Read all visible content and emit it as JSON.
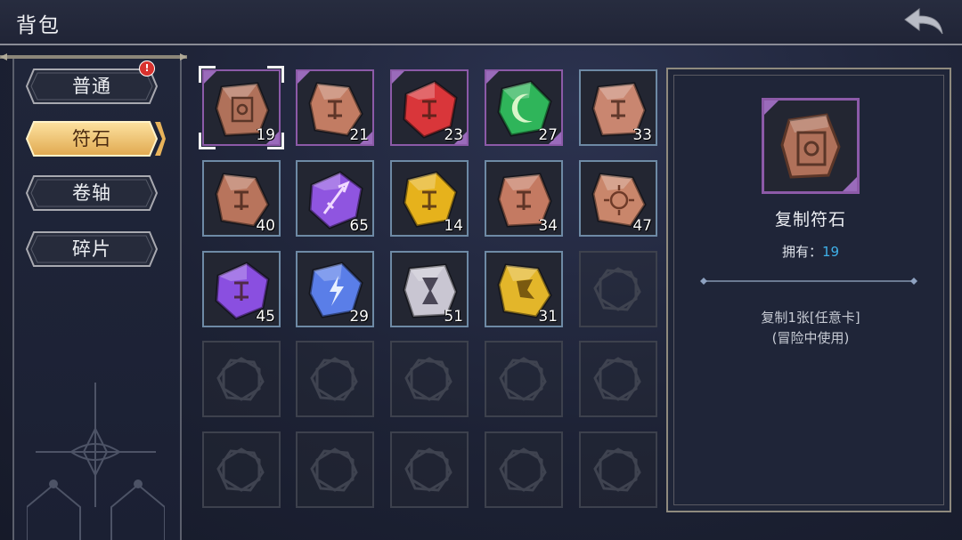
{
  "header": {
    "title": "背包"
  },
  "tabs": [
    {
      "label": "普通",
      "badge": "!"
    },
    {
      "label": "符石"
    },
    {
      "label": "卷轴"
    },
    {
      "label": "碎片"
    }
  ],
  "active_tab": "符石",
  "items": [
    {
      "count": "19",
      "color": "#b0715a",
      "rarity": "purple",
      "icon": "copy-rune"
    },
    {
      "count": "21",
      "color": "#c27c63",
      "rarity": "purple",
      "icon": "rune"
    },
    {
      "count": "23",
      "color": "#d9363a",
      "rarity": "purple",
      "icon": "rune"
    },
    {
      "count": "27",
      "color": "#2fb55a",
      "rarity": "purple",
      "icon": "moon-rune"
    },
    {
      "count": "33",
      "color": "#c98670",
      "rarity": "blue",
      "icon": "rune"
    },
    {
      "count": "40",
      "color": "#b8745c",
      "rarity": "blue",
      "icon": "rune"
    },
    {
      "count": "65",
      "color": "#8f55e0",
      "rarity": "blue",
      "icon": "sword-rune"
    },
    {
      "count": "14",
      "color": "#e6b21c",
      "rarity": "blue",
      "icon": "rune"
    },
    {
      "count": "34",
      "color": "#c47a62",
      "rarity": "blue",
      "icon": "rune"
    },
    {
      "count": "47",
      "color": "#c9866b",
      "rarity": "blue",
      "icon": "sun-rune"
    },
    {
      "count": "45",
      "color": "#8a4fe0",
      "rarity": "blue",
      "icon": "rune"
    },
    {
      "count": "29",
      "color": "#5a7ee8",
      "rarity": "blue",
      "icon": "lightning-rune"
    },
    {
      "count": "51",
      "color": "#c9c6d2",
      "rarity": "blue",
      "icon": "hourglass-rune"
    },
    {
      "count": "31",
      "color": "#e3b62a",
      "rarity": "blue",
      "icon": "star-rune"
    }
  ],
  "detail": {
    "name": "复制符石",
    "owned_label": "拥有：",
    "owned_value": "19",
    "desc_line1": "复制1张[任意卡]",
    "desc_line2": "(冒险中使用)",
    "color": "#b0715a"
  }
}
